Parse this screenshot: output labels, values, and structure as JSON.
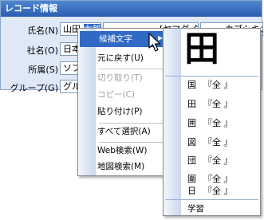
{
  "panel": {
    "title": "レコード情報"
  },
  "fields": [
    {
      "label": "氏名(N)",
      "value_parts": [
        "山田 ",
        "太郎"
      ],
      "value2": "[ヤマダ タロウ]",
      "value3": "カブシキガイシャ"
    },
    {
      "label": "社名(O)",
      "value": "日本"
    },
    {
      "label": "所属(S)",
      "value": "ソフ"
    },
    {
      "label": "グループ(G)",
      "value": "グル"
    }
  ],
  "context_menu": {
    "items": [
      {
        "label": "候補文字",
        "disabled": false,
        "has_submenu": true
      },
      {
        "label": "元に戻す(U)",
        "disabled": false
      },
      {
        "label": "切り取り(T)",
        "disabled": true
      },
      {
        "label": "コピー(C)",
        "disabled": true
      },
      {
        "label": "貼り付け(P)",
        "disabled": false
      },
      {
        "label": "すべて選択(A)",
        "disabled": false
      },
      {
        "label": "Web検索(W)",
        "disabled": false
      },
      {
        "label": "地図検索(M)",
        "disabled": false
      }
    ]
  },
  "candidate_menu": {
    "preview_char": "田",
    "candidates": [
      {
        "char": "国",
        "note": "『全 』"
      },
      {
        "char": "田",
        "note": "『全 』"
      },
      {
        "char": "囲",
        "note": "『全 』"
      },
      {
        "char": "図",
        "note": "『全 』"
      },
      {
        "char": "団",
        "note": "『全 』"
      },
      {
        "char": "圍",
        "note": "『全 』"
      },
      {
        "char": "日",
        "note": "『全 』"
      }
    ],
    "learn_label": "学習"
  },
  "colors": {
    "title_bar": "#2a5db0",
    "highlight": "#316ac5",
    "panel_bg": "#dfe8f6"
  }
}
